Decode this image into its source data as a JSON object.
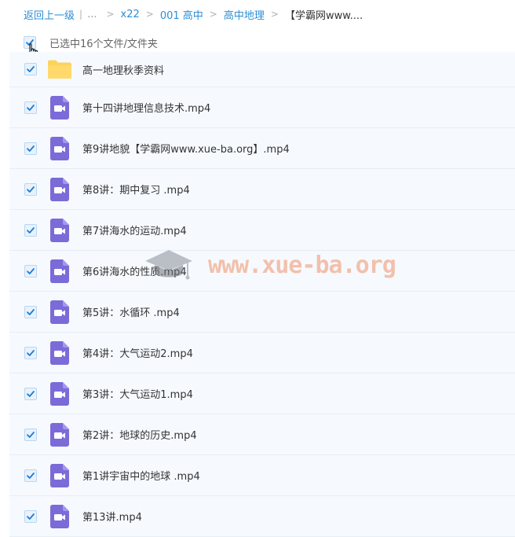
{
  "breadcrumb": {
    "back": "返回上一级",
    "ellipsis": "...",
    "separator": ">",
    "items": [
      "x22",
      "001 高中",
      "高中地理",
      "【学霸网www...."
    ]
  },
  "selection": {
    "text": "已选中16个文件/文件夹"
  },
  "files": [
    {
      "name": "高一地理秋季资料",
      "type": "folder-icon"
    },
    {
      "name": "第十四讲地理信息技术.mp4",
      "type": "video-file-icon"
    },
    {
      "name": "第9讲地貌【学霸网www.xue-ba.org】.mp4",
      "type": "video-file-icon"
    },
    {
      "name": "第8讲：期中复习 .mp4",
      "type": "video-file-icon"
    },
    {
      "name": "第7讲海水的运动.mp4",
      "type": "video-file-icon"
    },
    {
      "name": "第6讲海水的性质.mp4",
      "type": "video-file-icon"
    },
    {
      "name": "第5讲：水循环 .mp4",
      "type": "video-file-icon"
    },
    {
      "name": "第4讲：大气运动2.mp4",
      "type": "video-file-icon"
    },
    {
      "name": "第3讲：大气运动1.mp4",
      "type": "video-file-icon"
    },
    {
      "name": "第2讲：地球的历史.mp4",
      "type": "video-file-icon"
    },
    {
      "name": "第1讲宇宙中的地球 .mp4",
      "type": "video-file-icon"
    },
    {
      "name": "第13讲.mp4",
      "type": "video-file-icon"
    }
  ],
  "watermark": {
    "text": "www.xue-ba.org"
  },
  "colors": {
    "link": "#2b8ed6",
    "check": "#1e7bd4",
    "video_icon": "#7b6bd9",
    "folder_icon": "#fcd35d",
    "row_bg": "#f6faff"
  }
}
